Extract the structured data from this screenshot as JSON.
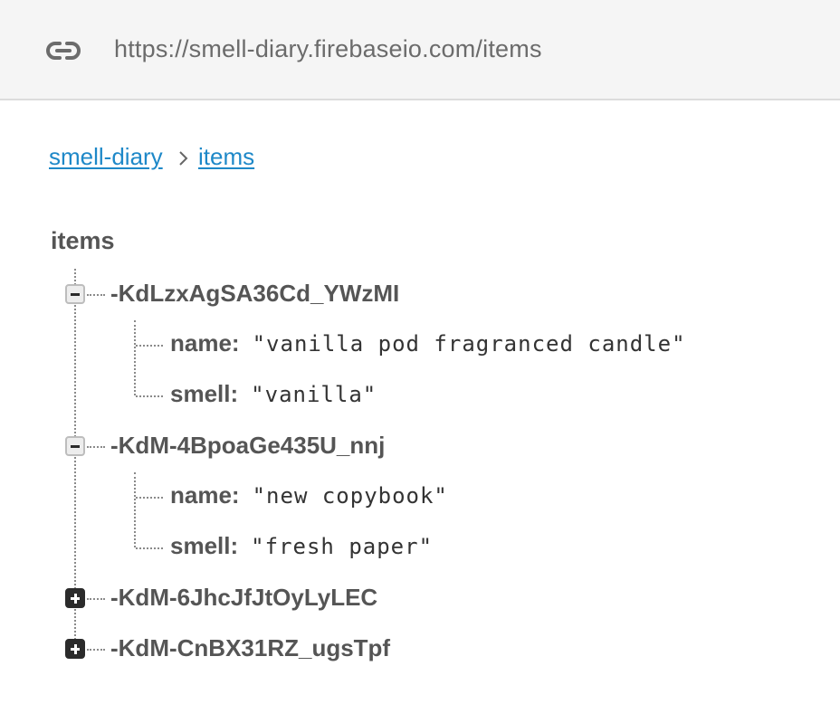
{
  "browser": {
    "url": "https://smell-diary.firebaseio.com/items",
    "icon": "link-icon"
  },
  "breadcrumb": {
    "root": "smell-diary",
    "current": "items",
    "separator_icon": "chevron-right-icon"
  },
  "tree": {
    "root": "items",
    "colon": ":",
    "nodes": [
      {
        "key": "-KdLzxAgSA36Cd_YWzMI",
        "expanded": true,
        "children": [
          {
            "key": "name",
            "value": "\"vanilla pod fragranced candle\""
          },
          {
            "key": "smell",
            "value": "\"vanilla\""
          }
        ]
      },
      {
        "key": "-KdM-4BpoaGe435U_nnj",
        "expanded": true,
        "children": [
          {
            "key": "name",
            "value": "\"new copybook\""
          },
          {
            "key": "smell",
            "value": "\"fresh paper\""
          }
        ]
      },
      {
        "key": "-KdM-6JhcJfJtOyLyLEC",
        "expanded": false
      },
      {
        "key": "-KdM-CnBX31RZ_ugsTpf",
        "expanded": false
      }
    ]
  }
}
